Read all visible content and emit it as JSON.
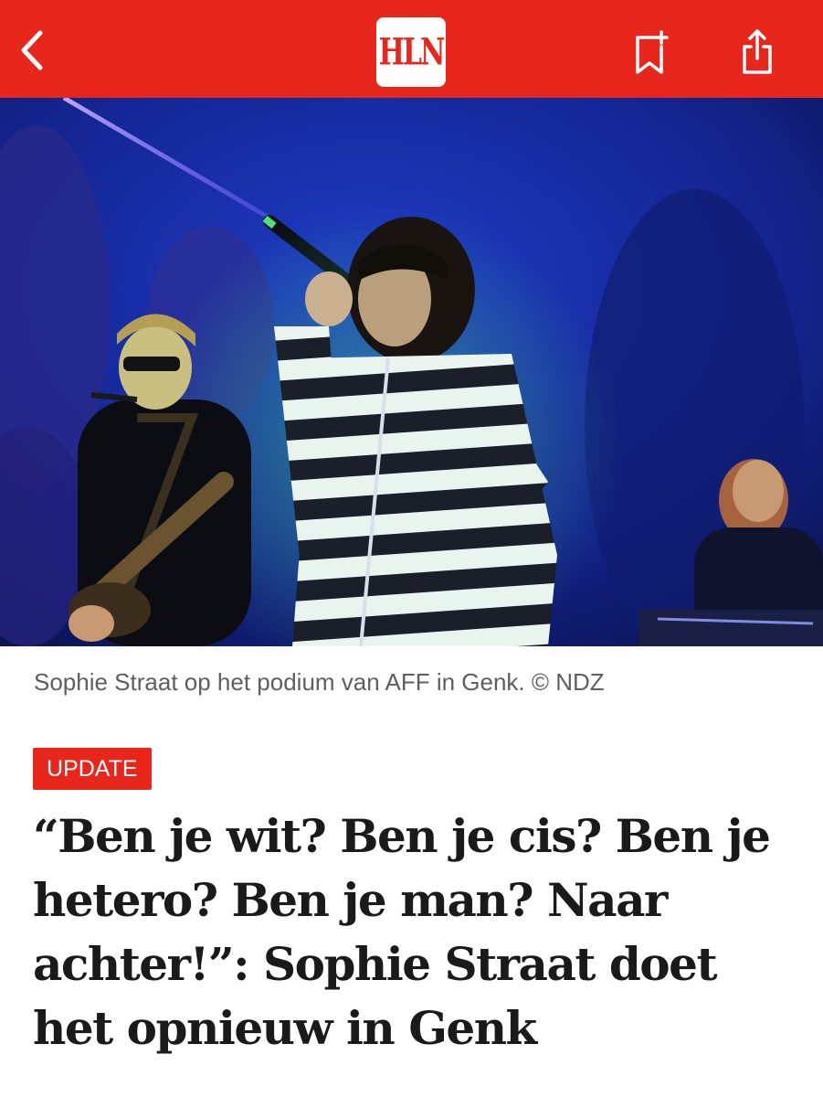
{
  "header": {
    "back_icon": "chevron-left-icon",
    "logo_text": "HLN",
    "bookmark_icon": "bookmark-add-icon",
    "share_icon": "share-icon",
    "bar_color": "#e8261b"
  },
  "article": {
    "image_description_icon": "concert-photo",
    "caption": "Sophie Straat op het podium van AFF in Genk. © NDZ",
    "badge": "UPDATE",
    "headline": "“Ben je wit? Ben je cis? Ben je hetero? Ben je man? Naar achter!”: Sophie Straat doet het opnieuw in Genk"
  }
}
